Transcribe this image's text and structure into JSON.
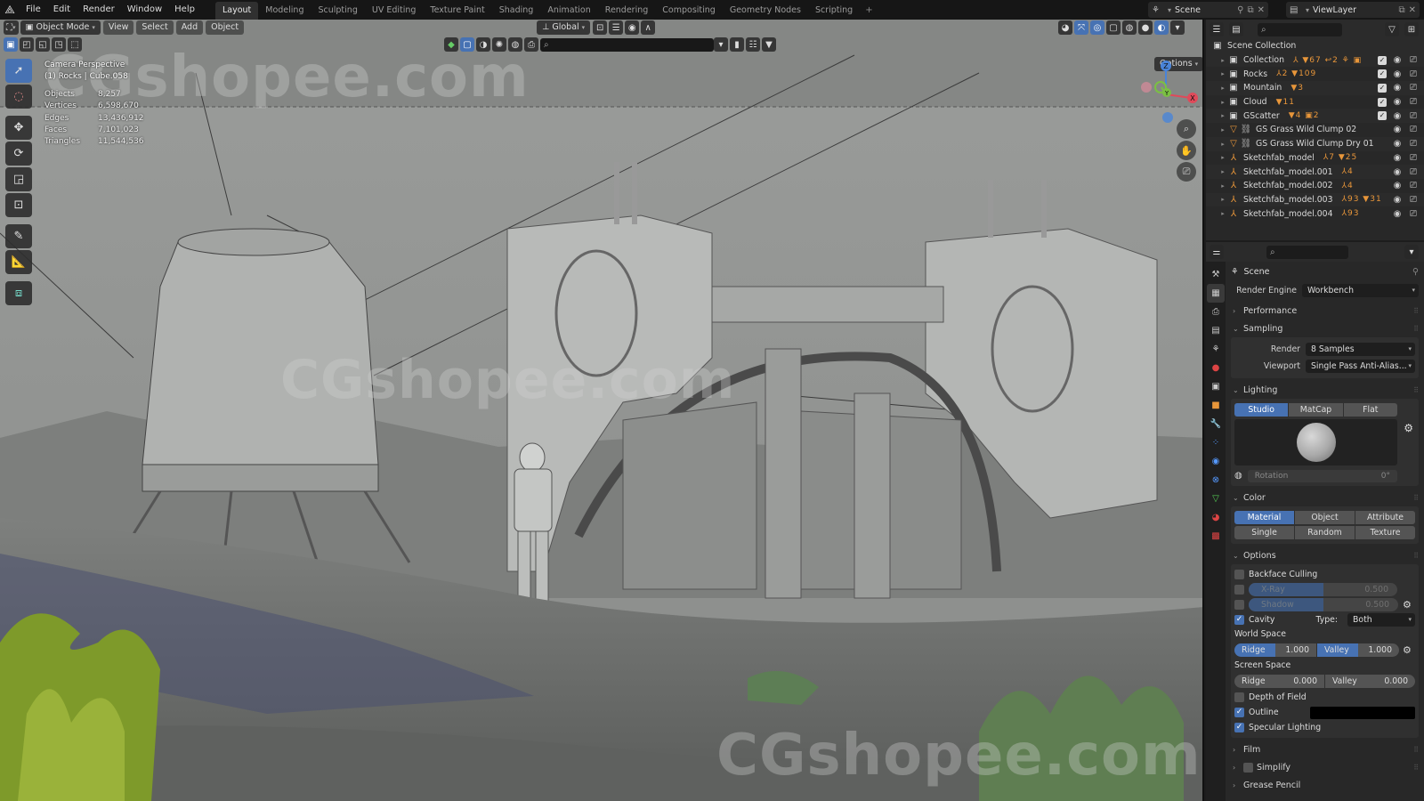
{
  "app": {
    "name": "Blender"
  },
  "topbar": {
    "menus": [
      "File",
      "Edit",
      "Render",
      "Window",
      "Help"
    ],
    "workspaces": [
      "Layout",
      "Modeling",
      "Sculpting",
      "UV Editing",
      "Texture Paint",
      "Shading",
      "Animation",
      "Rendering",
      "Compositing",
      "Geometry Nodes",
      "Scripting"
    ],
    "active_workspace": "Layout",
    "add_workspace": "+",
    "scene_name": "Scene",
    "view_layer_name": "ViewLayer"
  },
  "viewport": {
    "mode": "Object Mode",
    "menus": [
      "View",
      "Select",
      "Add",
      "Object"
    ],
    "transform_orientation": "Global",
    "options_label": "Options",
    "perspective_label": "Camera Perspective",
    "active_object_label": "(1) Rocks | Cube.058",
    "stats": [
      {
        "label": "Objects",
        "value": "8,257"
      },
      {
        "label": "Vertices",
        "value": "6,598,670"
      },
      {
        "label": "Edges",
        "value": "13,436,912"
      },
      {
        "label": "Faces",
        "value": "7,101,023"
      },
      {
        "label": "Triangles",
        "value": "11,544,536"
      }
    ],
    "gizmo_axes": [
      "Z",
      "Y",
      "X"
    ],
    "watermark": "CGshopee.com"
  },
  "outliner": {
    "root": "Scene Collection",
    "items": [
      {
        "name": "Collection",
        "type": "collection",
        "badges": "⅄ ▼67 ↩2 ⚘ ▣",
        "checked": true
      },
      {
        "name": "Rocks",
        "type": "collection",
        "badges": "⅄2 ▼109",
        "checked": true
      },
      {
        "name": "Mountain",
        "type": "collection",
        "badges": "▼3",
        "checked": true
      },
      {
        "name": "Cloud",
        "type": "collection",
        "badges": "▼11",
        "checked": true
      },
      {
        "name": "GScatter",
        "type": "collection",
        "badges": "▼4 ▣2",
        "checked": true
      },
      {
        "name": "GS Grass Wild Clump 02",
        "type": "mesh",
        "badges": "",
        "checked": null
      },
      {
        "name": "GS Grass Wild Clump Dry 01",
        "type": "mesh",
        "badges": "",
        "checked": null
      },
      {
        "name": "Sketchfab_model",
        "type": "empty",
        "badges": "⅄7 ▼25",
        "checked": null
      },
      {
        "name": "Sketchfab_model.001",
        "type": "empty",
        "badges": "⅄4",
        "checked": null
      },
      {
        "name": "Sketchfab_model.002",
        "type": "empty",
        "badges": "⅄4",
        "checked": null
      },
      {
        "name": "Sketchfab_model.003",
        "type": "empty",
        "badges": "⅄93 ▼31",
        "checked": null
      },
      {
        "name": "Sketchfab_model.004",
        "type": "empty",
        "badges": "⅄93",
        "checked": null
      }
    ]
  },
  "properties": {
    "context": "Scene",
    "render_engine_label": "Render Engine",
    "render_engine": "Workbench",
    "panels": {
      "performance": "Performance",
      "sampling": "Sampling",
      "lighting": "Lighting",
      "color": "Color",
      "options": "Options",
      "film": "Film",
      "simplify": "Simplify",
      "grease_pencil": "Grease Pencil"
    },
    "sampling": {
      "render_label": "Render",
      "render": "8 Samples",
      "viewport_label": "Viewport",
      "viewport": "Single Pass Anti-Alias..."
    },
    "lighting": {
      "modes": [
        "Studio",
        "MatCap",
        "Flat"
      ],
      "active": "Studio",
      "rotation_label": "Rotation",
      "rotation": "0°"
    },
    "color": {
      "modes": [
        "Material",
        "Object",
        "Attribute",
        "Single",
        "Random",
        "Texture"
      ],
      "active": "Material"
    },
    "options": {
      "backface_culling": {
        "label": "Backface Culling",
        "checked": false
      },
      "xray": {
        "label": "X-Ray",
        "value": "0.500",
        "fraction": 0.5,
        "checked": false
      },
      "shadow": {
        "label": "Shadow",
        "value": "0.500",
        "fraction": 0.5,
        "checked": false
      },
      "cavity": {
        "label": "Cavity",
        "checked": true,
        "type_label": "Type:",
        "type": "Both"
      },
      "world_space_label": "World Space",
      "world_ridge": {
        "label": "Ridge",
        "value": "1.000",
        "fraction": 0.5
      },
      "world_valley": {
        "label": "Valley",
        "value": "1.000",
        "fraction": 0.5
      },
      "screen_space_label": "Screen Space",
      "screen_ridge": {
        "label": "Ridge",
        "value": "0.000"
      },
      "screen_valley": {
        "label": "Valley",
        "value": "0.000"
      },
      "depth_of_field": {
        "label": "Depth of Field",
        "checked": false
      },
      "outline": {
        "label": "Outline",
        "checked": true,
        "color": "#000000"
      },
      "specular": {
        "label": "Specular Lighting",
        "checked": true
      }
    }
  },
  "colors": {
    "accent": "#4772b3",
    "object_orange": "#e8963a"
  }
}
